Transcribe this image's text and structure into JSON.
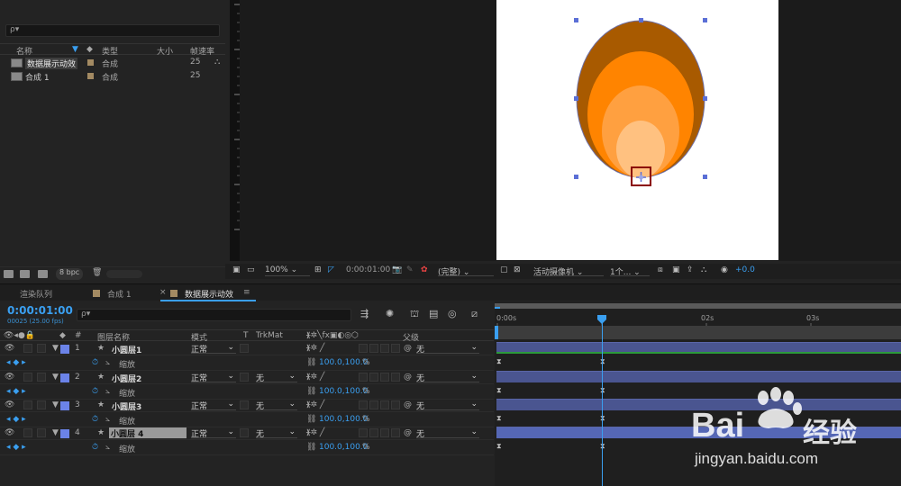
{
  "project": {
    "search_placeholder": "ρ▾",
    "columns": {
      "name": "名称",
      "type": "类型",
      "size": "大小",
      "fps": "帧速率"
    },
    "items": [
      {
        "name": "数据展示动效",
        "type": "合成",
        "fps": "25"
      },
      {
        "name": "合成 1",
        "type": "合成",
        "fps": "25"
      }
    ],
    "footer": {
      "bpc": "8 bpc"
    }
  },
  "viewer": {
    "zoom": "100%",
    "timecode": "0:00:01:00",
    "resolution": "(完整)",
    "camera": "活动摄像机",
    "views": "1个...",
    "exposure": "+0.0"
  },
  "timeline": {
    "tabs": [
      "渲染队列",
      "合成 1",
      "数据展示动效"
    ],
    "timecode": "0:00:01:00",
    "fps_label": "00025 (25.00 fps)",
    "search_placeholder": "ρ▾",
    "columns": {
      "num": "#",
      "layer_name": "图层名称",
      "mode": "模式",
      "t": "T",
      "trkmat": "TrkMat",
      "parent": "父级"
    },
    "ruler": [
      "0:00s",
      "02s",
      "03s"
    ],
    "layers": [
      {
        "num": "1",
        "name": "小圆层1",
        "mode": "正常",
        "trkmat": "",
        "parent": "无",
        "sub_label": "缩放",
        "sub_value": "100.0,100.0",
        "sub_unit": "%"
      },
      {
        "num": "2",
        "name": "小圆层2",
        "mode": "正常",
        "trkmat": "无",
        "parent": "无",
        "sub_label": "缩放",
        "sub_value": "100.0,100.0",
        "sub_unit": "%"
      },
      {
        "num": "3",
        "name": "小圆层3",
        "mode": "正常",
        "trkmat": "无",
        "parent": "无",
        "sub_label": "缩放",
        "sub_value": "100.0,100.0",
        "sub_unit": "%"
      },
      {
        "num": "4",
        "name": "小圆层 4",
        "mode": "正常",
        "trkmat": "无",
        "parent": "无",
        "sub_label": "缩放",
        "sub_value": "100.0,100.0",
        "sub_unit": "%"
      }
    ]
  },
  "watermark": {
    "brand": "Bai",
    "brand2": "经验",
    "url": "jingyan.baidu.com"
  },
  "colors": {
    "accent": "#3a9ff0",
    "layer_label": "#6b83e8",
    "orange_outer": "#a85a00",
    "orange_mid": "#ff8a00"
  }
}
